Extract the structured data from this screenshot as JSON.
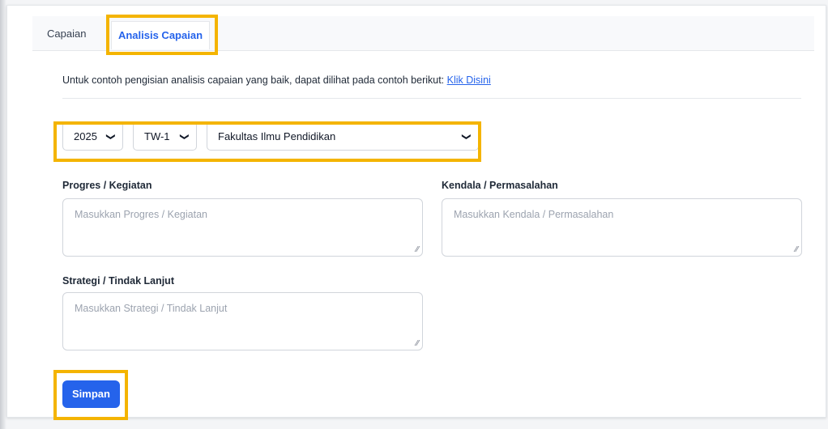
{
  "tabs": [
    {
      "label": "Capaian",
      "active": false
    },
    {
      "label": "Analisis Capaian",
      "active": true
    }
  ],
  "info": {
    "text": "Untuk contoh pengisian analisis capaian yang baik, dapat dilihat pada contoh berikut: ",
    "link_label": "Klik Disini"
  },
  "filters": {
    "year": "2025",
    "period": "TW-1",
    "faculty": "Fakultas Ilmu Pendidikan"
  },
  "fields": {
    "progres": {
      "label": "Progres / Kegiatan",
      "placeholder": "Masukkan Progres / Kegiatan"
    },
    "kendala": {
      "label": "Kendala / Permasalahan",
      "placeholder": "Masukkan Kendala / Permasalahan"
    },
    "strategi": {
      "label": "Strategi / Tindak Lanjut",
      "placeholder": "Masukkan Strategi / Tindak Lanjut"
    }
  },
  "actions": {
    "save_label": "Simpan"
  },
  "colors": {
    "accent": "#2563eb",
    "highlight": "#f4b400"
  }
}
